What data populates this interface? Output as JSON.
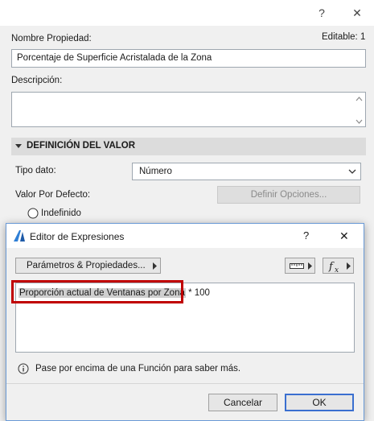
{
  "bg_dialog": {
    "title_buttons": {
      "help": "?",
      "close": "✕"
    },
    "property_name_label": "Nombre Propiedad:",
    "editable_label": "Editable: 1",
    "property_name_value": "Porcentaje de Superficie Acristalada de la Zona",
    "description_label": "Descripción:",
    "section_title": "DEFINICIÓN DEL VALOR",
    "data_type_label": "Tipo dato:",
    "data_type_value": "Número",
    "default_value_label": "Valor Por Defecto:",
    "define_options_button": "Definir Opciones...",
    "undefined_radio_label": "Indefinido"
  },
  "expr_dialog": {
    "title": "Editor de Expresiones",
    "help": "?",
    "close": "✕",
    "params_button": "Parámetros & Propiedades...",
    "expression_param": "Proporción actual de Ventanas por Zona",
    "expression_rest": " * 100",
    "info_text": "Pase por encima de una Función para saber más.",
    "cancel_button": "Cancelar",
    "ok_button": "OK",
    "highlight_color": "#c00000",
    "accent_color": "#3a6fd0"
  }
}
